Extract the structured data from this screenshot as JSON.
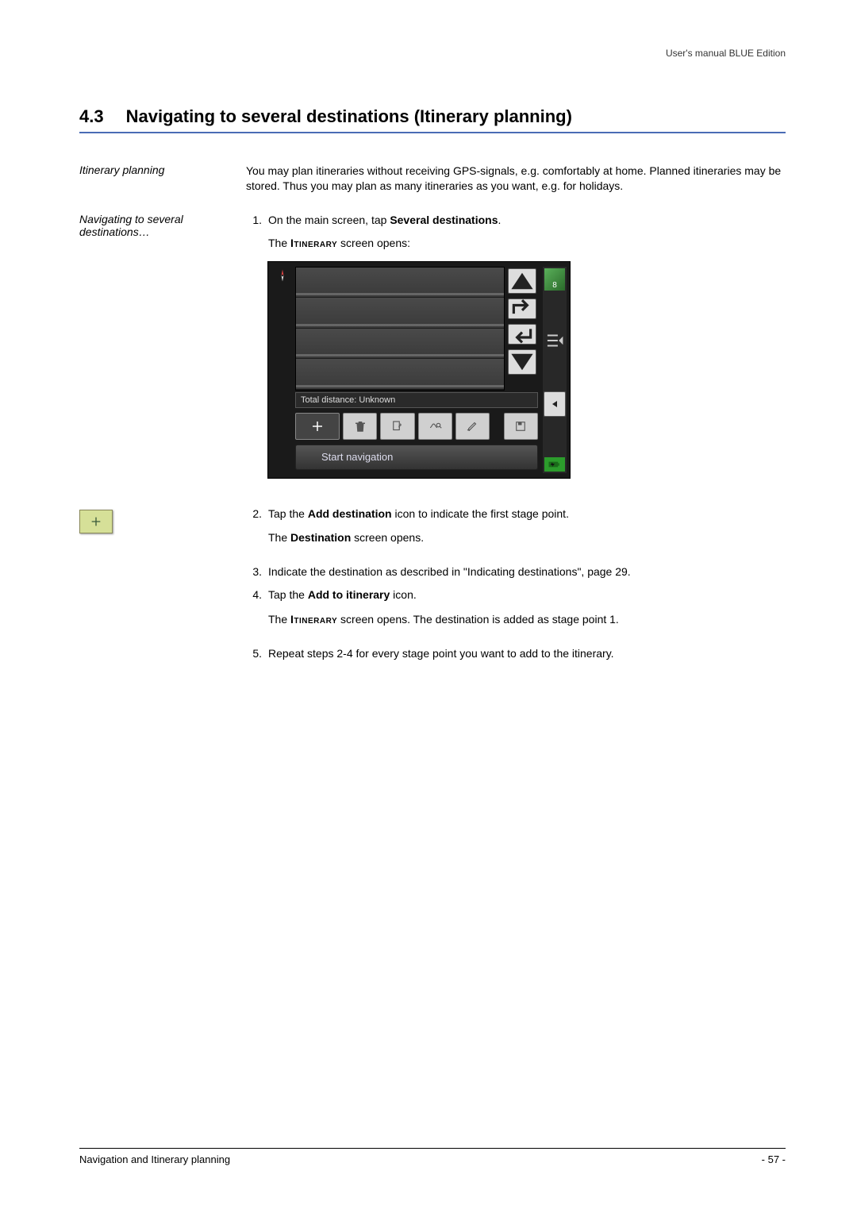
{
  "header": {
    "manual_title": "User's manual BLUE Edition"
  },
  "section": {
    "number": "4.3",
    "title": "Navigating to several destinations (Itinerary planning)"
  },
  "block1": {
    "side_label": "Itinerary planning",
    "text": "You may plan itineraries without receiving GPS-signals, e.g. comfortably at home. Planned itineraries may be stored. Thus you may plan as many itineraries as you want, e.g. for holidays."
  },
  "block2": {
    "side_label": "Navigating to several destinations…",
    "step1_prefix": "On the main screen, tap ",
    "step1_bold": "Several destinations",
    "step1_suffix": ".",
    "itinerary_intro_prefix": "The ",
    "itinerary_intro_name": "Itinerary",
    "itinerary_intro_suffix": " screen opens:"
  },
  "device": {
    "distance_label": "Total distance: Unknown",
    "start_nav_label": "Start navigation",
    "sat_count": "8"
  },
  "step2": {
    "prefix": "Tap the ",
    "bold": "Add destination",
    "suffix": " icon to indicate the first stage point.",
    "sub_prefix": "The ",
    "sub_bold": "Destination",
    "sub_suffix": " screen opens."
  },
  "step3": {
    "text": "Indicate the destination as described in \"Indicating destinations\", page 29."
  },
  "step4": {
    "prefix": "Tap the ",
    "bold": "Add to itinerary",
    "suffix": " icon.",
    "sub_prefix": "The ",
    "sub_name": "Itinerary",
    "sub_suffix": " screen opens. The destination is added as stage point 1."
  },
  "step5": {
    "text": "Repeat steps 2-4 for every stage point you want to add to the itinerary."
  },
  "footer": {
    "left": "Navigation and Itinerary planning",
    "right": "- 57 -"
  }
}
